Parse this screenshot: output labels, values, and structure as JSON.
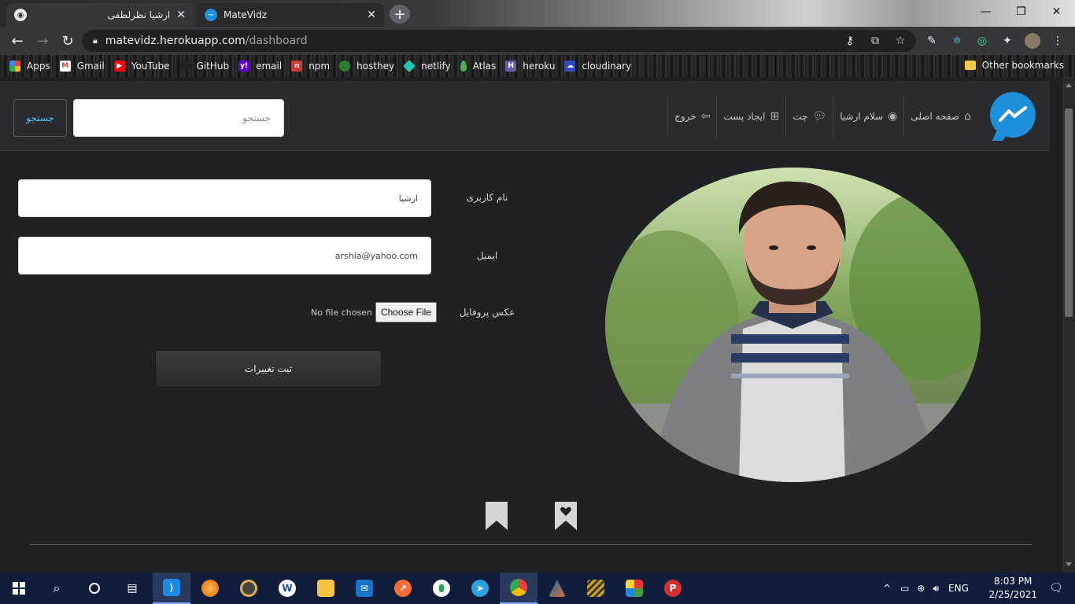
{
  "browser": {
    "tabs": [
      {
        "title": "ارشیا نظرلطفی",
        "close": "✕"
      },
      {
        "title": "MateVidz",
        "close": "✕"
      }
    ],
    "new_tab": "+",
    "window_controls": {
      "minimize": "—",
      "maximize": "❐",
      "close": "✕"
    },
    "url_host": "matevidz.herokuapp.com",
    "url_path": "/dashboard",
    "bookmarks": [
      {
        "label": "Apps",
        "icon": "apps-grid-icon",
        "color": "#e94235"
      },
      {
        "label": "Gmail",
        "icon": "gmail-icon",
        "color": "#ea4335"
      },
      {
        "label": "YouTube",
        "icon": "youtube-icon",
        "color": "#ff0000"
      },
      {
        "label": "GitHub",
        "icon": "github-icon",
        "color": "#444444"
      },
      {
        "label": "email",
        "icon": "yahoo-icon",
        "color": "#6001d2"
      },
      {
        "label": "npm",
        "icon": "npm-icon",
        "color": "#cb3837"
      },
      {
        "label": "hosthey",
        "icon": "hosthey-icon",
        "color": "#2e7d32"
      },
      {
        "label": "netlify",
        "icon": "netlify-icon",
        "color": "#20c6b7"
      },
      {
        "label": "Atlas",
        "icon": "mongodb-leaf-icon",
        "color": "#4caf50"
      },
      {
        "label": "heroku",
        "icon": "heroku-icon",
        "color": "#6762a6"
      },
      {
        "label": "cloudinary",
        "icon": "cloudinary-icon",
        "color": "#3448c5"
      }
    ],
    "other_bookmarks": "Other bookmarks"
  },
  "navbar": {
    "links": [
      {
        "label": "صفحه اصلی",
        "icon": "home-icon"
      },
      {
        "label": "سلام ارشیا",
        "icon": "user-circle-icon"
      },
      {
        "label": "چت",
        "icon": "chat-icon"
      },
      {
        "label": "ایجاد پست",
        "icon": "plus-square-icon"
      },
      {
        "label": "خروج",
        "icon": "logout-icon"
      }
    ],
    "search_placeholder": "جستجو",
    "search_button": "جستجو",
    "logo": "messenger-logo-icon"
  },
  "profile_form": {
    "username_label": "نام کاربری",
    "username_value": "ارشیا",
    "email_label": "ایمیل",
    "email_value": "arshia@yahoo.com",
    "photo_label": "عکس پروفایل",
    "file_button": "Choose File",
    "file_status": "No file chosen",
    "submit": "ثبت تغییرات"
  },
  "tabs_icons": [
    "bookmark-icon",
    "heart-bookmark-icon"
  ],
  "taskbar": {
    "language": "ENG",
    "time": "8:03 PM",
    "date": "2/25/2021"
  },
  "colors": {
    "page_bg": "#202124",
    "navbar_bg": "#2a2b2e",
    "accent": "#4fc3f7",
    "logo": "#1d8fdb",
    "taskbar": "#101d3d"
  }
}
